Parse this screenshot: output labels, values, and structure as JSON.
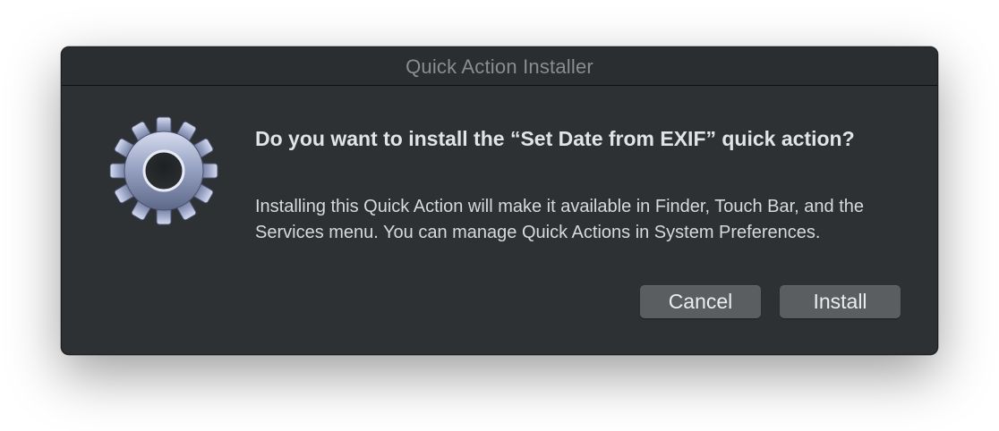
{
  "window": {
    "title": "Quick Action Installer"
  },
  "dialog": {
    "icon": "gear-icon",
    "heading": "Do you want to install the “Set Date from EXIF” quick action?",
    "message": "Installing this Quick Action will make it available in Finder, Touch Bar, and the Services menu. You can manage Quick Actions in System Preferences."
  },
  "buttons": {
    "cancel_label": "Cancel",
    "install_label": "Install"
  },
  "colors": {
    "window_background": "#2e3133",
    "button_background": "#5b5e61",
    "gear_fill": "#8f9ab8"
  }
}
